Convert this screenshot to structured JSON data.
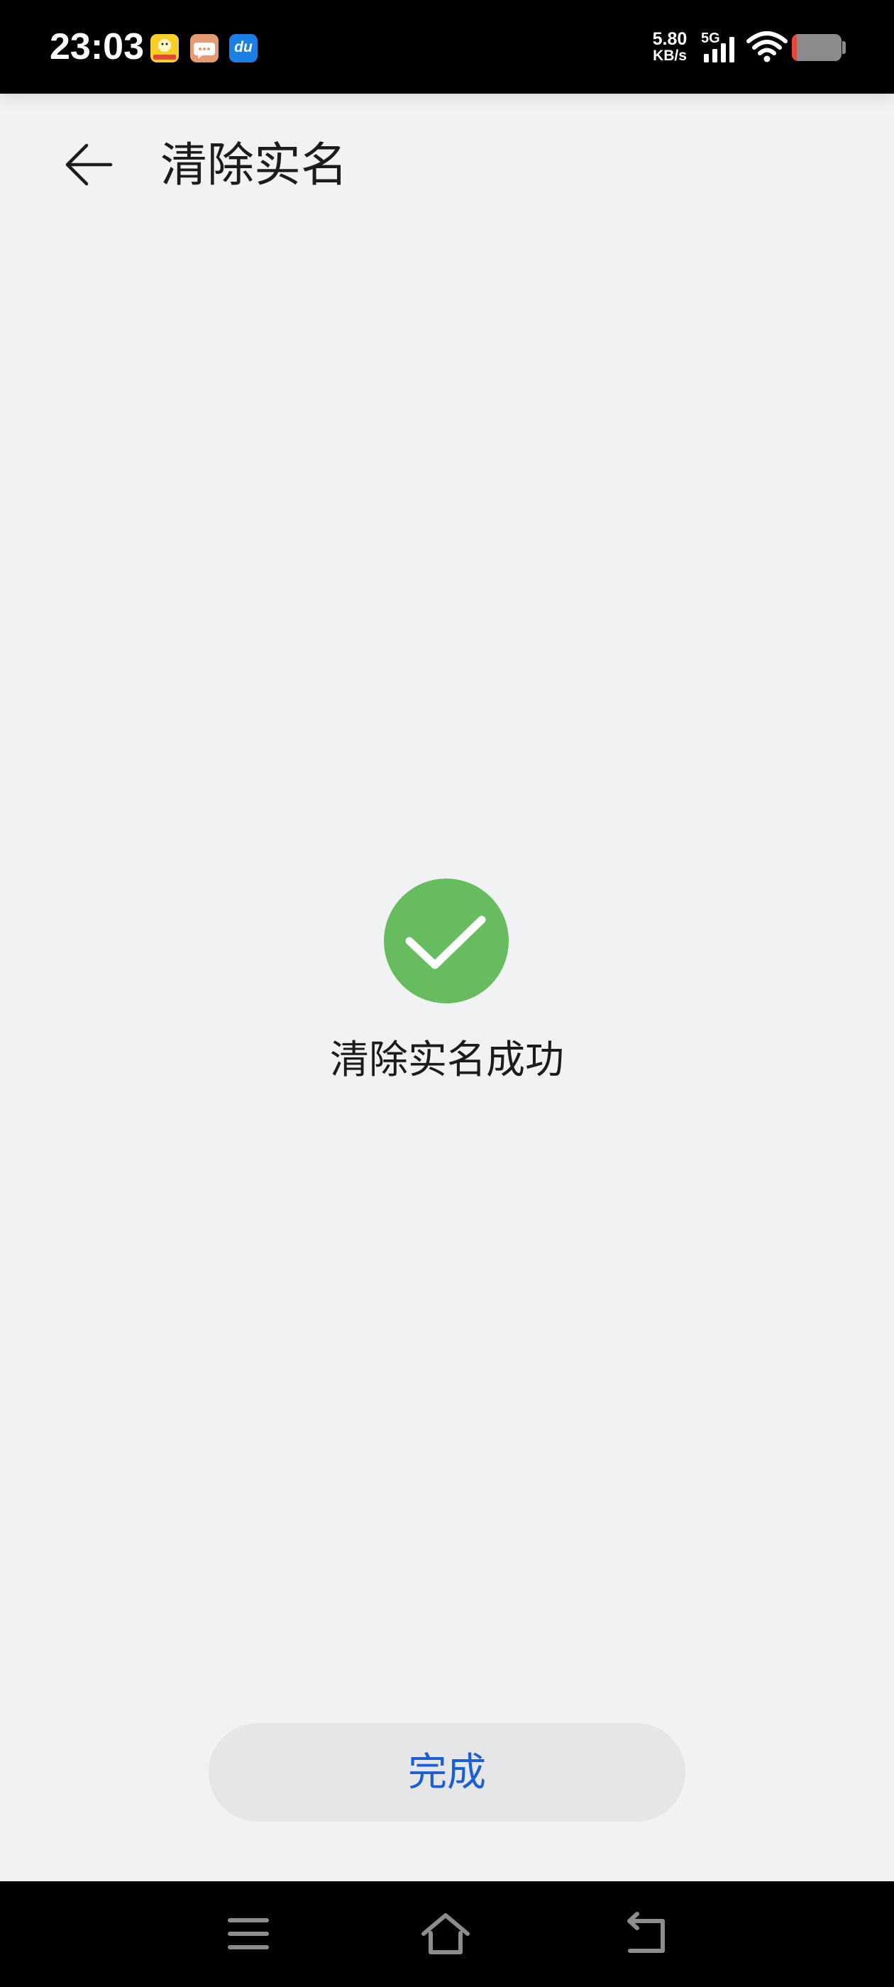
{
  "status_bar": {
    "time": "23:03",
    "notification_icons": [
      "yellow-app-icon",
      "chat-bubble-icon",
      "du-app-icon"
    ],
    "du_icon_text": "du",
    "net_speed": "5.80",
    "net_speed_unit": "KB/s",
    "network_type": "5G",
    "signal_icon": "cellular-signal-icon",
    "wifi_icon": "wifi-icon",
    "battery_level": 0.1,
    "battery_low_color": "#e8463c"
  },
  "header": {
    "back_icon": "back-arrow-icon",
    "title": "清除实名"
  },
  "result": {
    "icon": "check-circle-icon",
    "message": "清除实名成功",
    "success_color": "#66bc5f"
  },
  "footer": {
    "done_label": "完成",
    "accent_color": "#1a5fd4"
  },
  "nav_bar": {
    "icons": [
      "menu-icon",
      "home-icon",
      "back-icon"
    ]
  }
}
